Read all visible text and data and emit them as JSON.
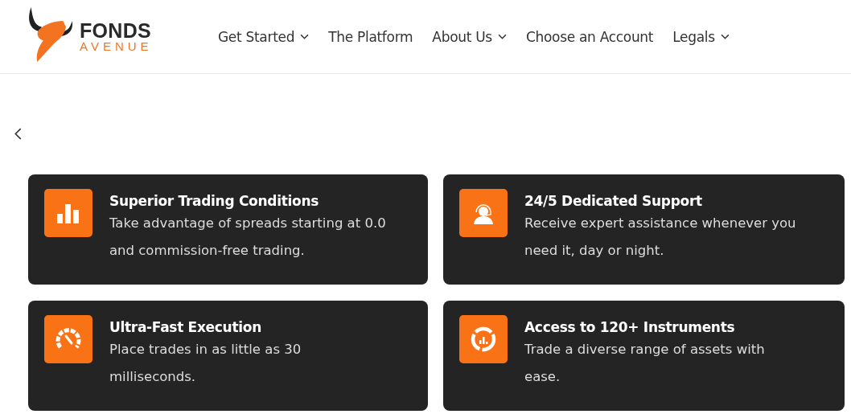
{
  "logo": {
    "line_1": "FONDS",
    "line_2": "AVENUE"
  },
  "nav": [
    {
      "label": "Get Started",
      "dropdown": true
    },
    {
      "label": "The Platform",
      "dropdown": false
    },
    {
      "label": "About Us",
      "dropdown": true
    },
    {
      "label": "Choose an Account",
      "dropdown": false
    },
    {
      "label": "Legals",
      "dropdown": true
    }
  ],
  "features": [
    {
      "kind": "bars",
      "title": "Superior Trading Conditions",
      "text": "Take advantage of spreads starting at 0.0 and commission-free trading."
    },
    {
      "kind": "support",
      "title": "24/5 Dedicated Support",
      "text": "Receive expert assistance whenever you need it, day or night."
    },
    {
      "kind": "gauge",
      "title": "Ultra-Fast Execution",
      "text": "Place trades in as little as 30 milliseconds."
    },
    {
      "kind": "ring",
      "title": "Access to 120+ Instruments",
      "text": "Trade a diverse range of assets with ease."
    }
  ]
}
